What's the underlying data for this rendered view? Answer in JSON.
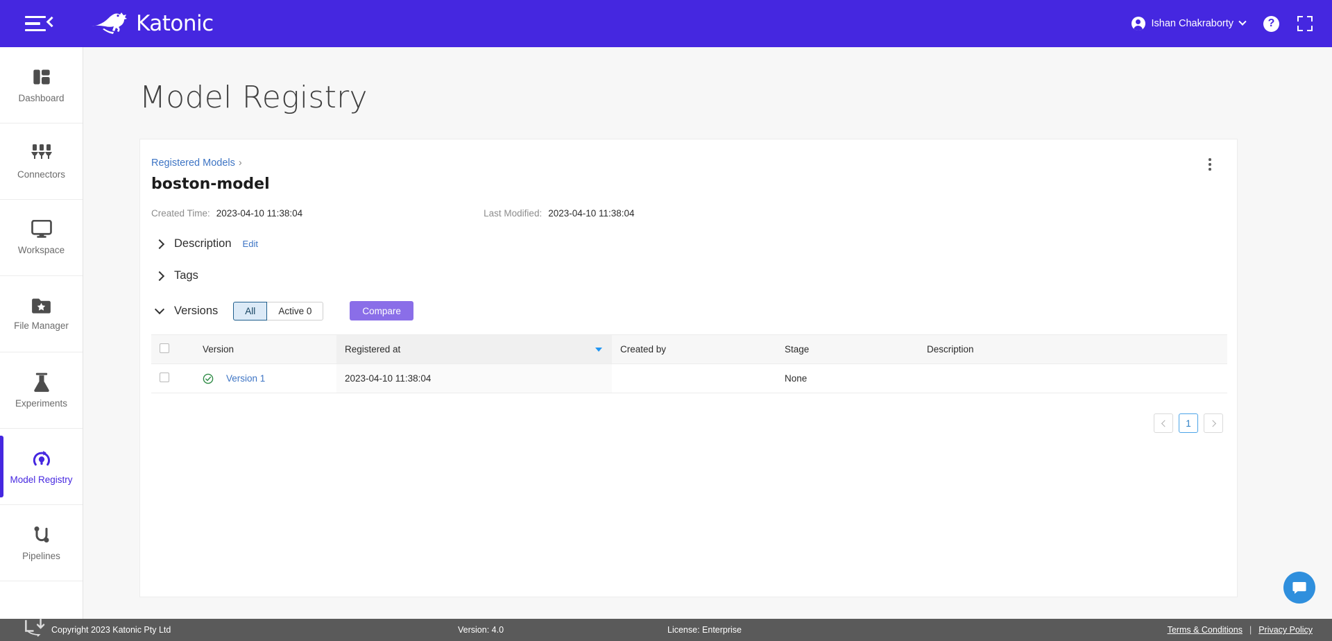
{
  "topbar": {
    "menu_icon": "hamburger-collapse-icon",
    "brand_name": "Katonic",
    "brand_logo_icon": "kangaroo-logo-icon",
    "user_name": "Ishan Chakraborty",
    "user_chevron_icon": "chevron-down-icon",
    "help_icon": "question-mark-help-icon",
    "help_label": "?",
    "fullscreen_icon": "fullscreen-expand-icon",
    "accent_color": "#4527e0"
  },
  "sidebar": {
    "items": [
      {
        "label": "Dashboard",
        "icon": "dashboard-grid-icon",
        "active": false
      },
      {
        "label": "Connectors",
        "icon": "connectors-plug-icon",
        "active": false
      },
      {
        "label": "Workspace",
        "icon": "monitor-icon",
        "active": false
      },
      {
        "label": "File Manager",
        "icon": "folder-star-icon",
        "active": false
      },
      {
        "label": "Experiments",
        "icon": "flask-icon",
        "active": false
      },
      {
        "label": "Model Registry",
        "icon": "model-registry-icon",
        "active": true
      },
      {
        "label": "Pipelines",
        "icon": "pipeline-curve-icon",
        "active": false
      }
    ],
    "active_color": "#4527e0"
  },
  "main": {
    "page_title": "Model Registry",
    "breadcrumb": {
      "label": "Registered Models",
      "separator": "›"
    },
    "model_name": "boston-model",
    "kebab_icon": "more-vertical-icon",
    "meta": {
      "created_label": "Created Time:",
      "created_value": "2023-04-10 11:38:04",
      "modified_label": "Last Modified:",
      "modified_value": "2023-04-10 11:38:04"
    },
    "sections": {
      "description": {
        "title": "Description",
        "edit_label": "Edit",
        "expanded": false,
        "caret_icon": "chevron-right-icon"
      },
      "tags": {
        "title": "Tags",
        "expanded": false,
        "caret_icon": "chevron-right-icon"
      },
      "versions": {
        "title": "Versions",
        "expanded": true,
        "caret_icon": "chevron-down-icon"
      }
    },
    "version_filters": {
      "all_label": "All",
      "active_label": "Active 0",
      "selected": "All",
      "compare_label": "Compare",
      "compare_color": "#8a6ee8"
    },
    "table": {
      "columns": [
        "Version",
        "Registered at",
        "Created by",
        "Stage",
        "Description"
      ],
      "sorted_column": "Registered at",
      "sort_icon": "sort-descending-arrow-icon",
      "select_all_icon": "checkbox-unchecked-icon",
      "rows": [
        {
          "checkbox_icon": "checkbox-unchecked-icon",
          "status_icon": "check-circle-icon",
          "version": "Version 1",
          "registered_at": "2023-04-10 11:38:04",
          "created_by": "",
          "stage": "None",
          "description": ""
        }
      ]
    },
    "pagination": {
      "prev_icon": "chevron-left-icon",
      "next_icon": "chevron-right-icon",
      "current_page": "1"
    }
  },
  "footer": {
    "install_icon": "install-app-icon",
    "copyright": "Copyright 2023 Katonic Pty Ltd",
    "version": "Version: 4.0",
    "license": "License: Enterprise",
    "terms": "Terms & Conditions",
    "divider": "|",
    "privacy": "Privacy Policy"
  },
  "chat": {
    "icon": "chat-bubble-icon",
    "color": "#2f8fdd"
  }
}
